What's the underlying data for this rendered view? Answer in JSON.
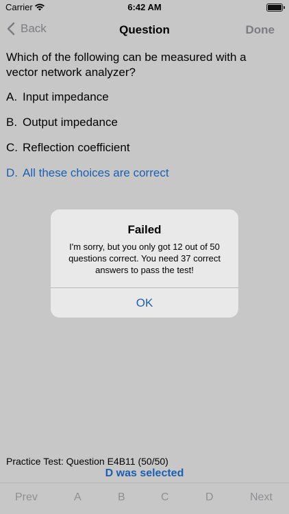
{
  "status_bar": {
    "carrier": "Carrier",
    "time": "6:42 AM"
  },
  "nav": {
    "back_label": "Back",
    "title": "Question",
    "done_label": "Done"
  },
  "question": {
    "text": "Which of the following can be measured with a vector network analyzer?",
    "choices": [
      {
        "letter": "A.",
        "text": "Input impedance"
      },
      {
        "letter": "B.",
        "text": "Output impedance"
      },
      {
        "letter": "C.",
        "text": "Reflection coefficient"
      },
      {
        "letter": "D.",
        "text": "All these choices are correct"
      }
    ]
  },
  "alert": {
    "title": "Failed",
    "message": "I'm sorry, but you only got 12 out of 50 questions correct.  You need 37 correct answers to pass the test!",
    "ok_label": "OK"
  },
  "footer": {
    "info": "Practice Test:  Question E4B11 (50/50)",
    "selected": "D was selected"
  },
  "toolbar": {
    "prev": "Prev",
    "a": "A",
    "b": "B",
    "c": "C",
    "d": "D",
    "next": "Next"
  },
  "colors": {
    "accent": "#1b5fb2",
    "dimmed_background": "#c7c7c7",
    "alert_background": "#e9e9e9"
  }
}
